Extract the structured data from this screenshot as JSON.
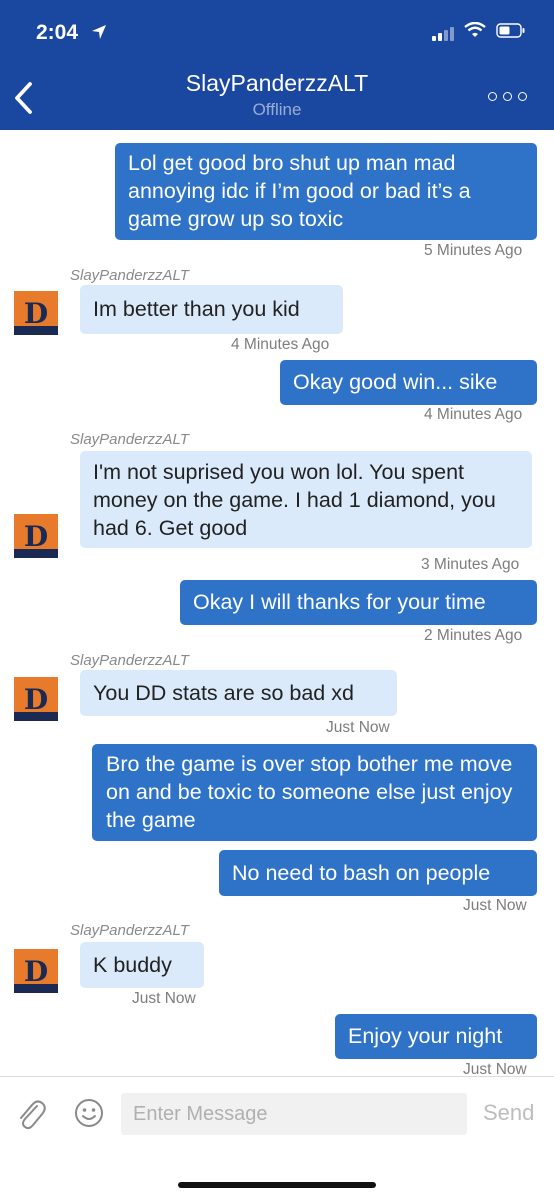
{
  "status_bar": {
    "time": "2:04"
  },
  "header": {
    "title": "SlayPanderzzALT",
    "status": "Offline"
  },
  "messages": [
    {
      "sender": "",
      "text": "Lol get good bro shut up man mad annoying idc if I’m good or bad it’s a game grow up so toxic",
      "time": "5 Minutes Ago"
    },
    {
      "sender": "SlayPanderzzALT",
      "text": "Im better than you kid",
      "time": "4 Minutes Ago"
    },
    {
      "sender": "",
      "text": "Okay good win... sike",
      "time": "4 Minutes Ago"
    },
    {
      "sender": "SlayPanderzzALT",
      "text": "I'm not suprised you won lol. You spent money on the game. I had 1 diamond, you had 6. Get good",
      "time": "3 Minutes Ago"
    },
    {
      "sender": "",
      "text": "Okay I will thanks for your time",
      "time": "2 Minutes Ago"
    },
    {
      "sender": "SlayPanderzzALT",
      "text": "You DD stats are so bad xd",
      "time": "Just Now"
    },
    {
      "sender": "",
      "text": "Bro the game is over stop bother me move on and be toxic to someone else just enjoy the game",
      "time": ""
    },
    {
      "sender": "",
      "text": "No need to bash on people",
      "time": "Just Now"
    },
    {
      "sender": "SlayPanderzzALT",
      "text": "K buddy",
      "time": "Just Now"
    },
    {
      "sender": "",
      "text": "Enjoy your night",
      "time": "Just Now"
    }
  ],
  "composer": {
    "placeholder": "Enter Message",
    "send_label": "Send"
  },
  "colors": {
    "header": "#1a47a0",
    "outgoing_bubble": "#2f73c9",
    "incoming_bubble": "#dbeafb",
    "avatar_orange": "#e87a2c",
    "avatar_navy": "#1b2a52"
  },
  "icons": {
    "back": "chevron-left-icon",
    "more": "more-icon",
    "attach": "paperclip-icon",
    "emoji": "smiley-icon",
    "avatar": "team-logo-icon"
  }
}
